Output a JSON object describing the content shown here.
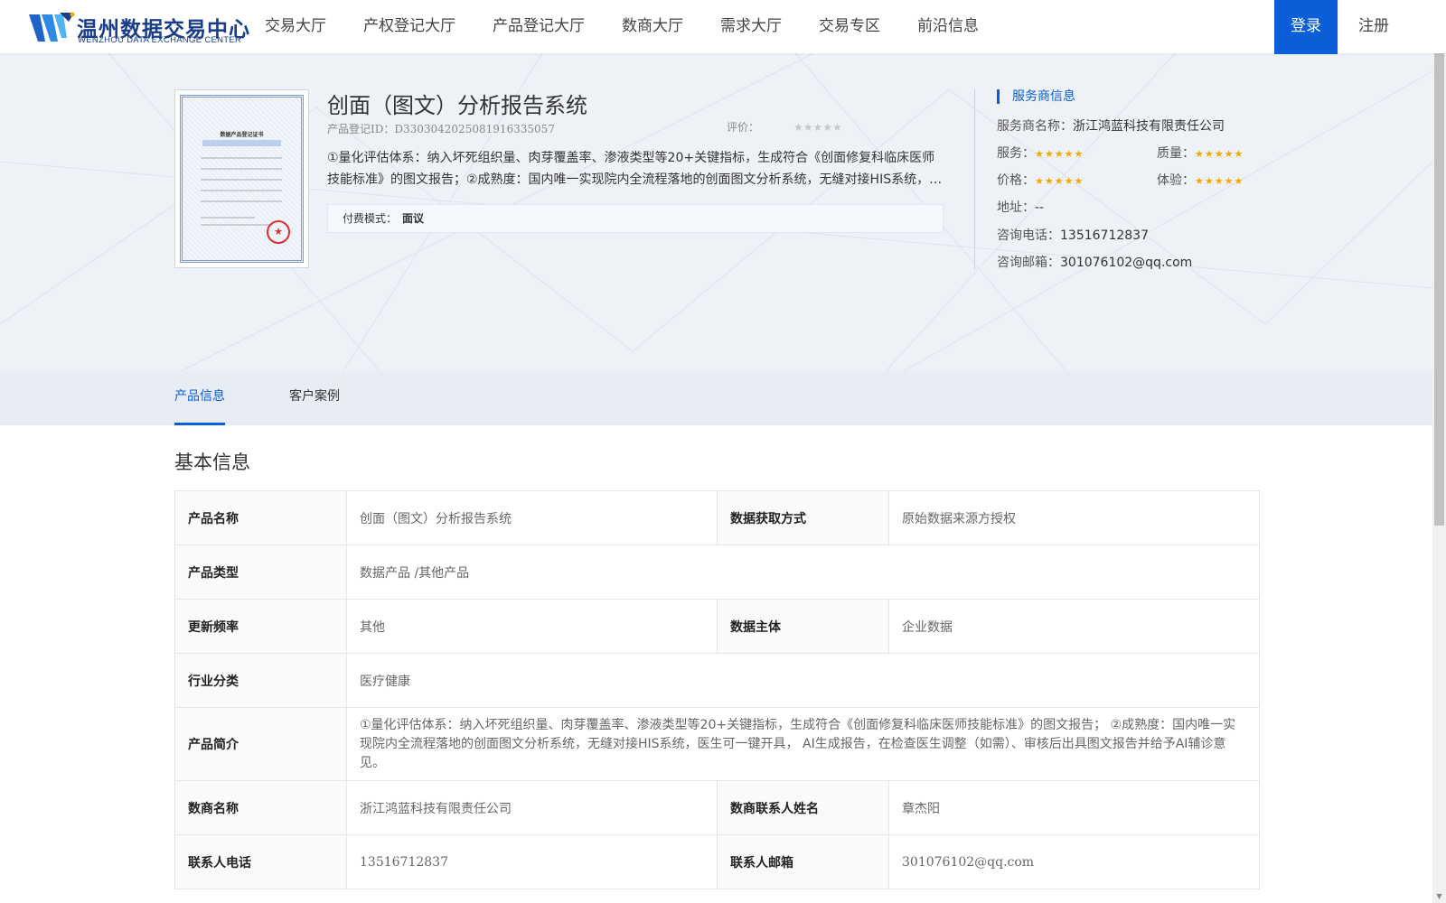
{
  "header": {
    "logo_cn": "温州数据交易中心",
    "logo_en": "WENZHOU DATA EXCHANGE CENTER",
    "nav": [
      "交易大厅",
      "产权登记大厅",
      "产品登记大厅",
      "数商大厅",
      "需求大厅",
      "交易专区",
      "前沿信息"
    ],
    "login_label": "登录",
    "register_label": "注册"
  },
  "product": {
    "title": "创面（图文）分析报告系统",
    "id_text": "产品登记ID：D3303042025081916335057",
    "rating_label": "评价：",
    "rating_stars": "★★★★★",
    "rating_value": 0,
    "description": "①量化评估体系：纳入坏死组织量、肉芽覆盖率、渗液类型等20+关键指标，生成符合《创面修复科临床医师技能标准》的图文报告；②成熟度：国内唯一实现院内全流程落地的创面图文分析系统，无缝对接HIS系统，医生可一键开具，AI生成报告，在检查医生调整（如需）、审核后出具图文报告并给予AI辅诊意见。",
    "pay_label": "付费模式：",
    "pay_value": "面议",
    "cert_title": "数据产品登记证书"
  },
  "provider": {
    "heading": "服务商信息",
    "name_label": "服务商名称：",
    "name_value": "浙江鸿蓝科技有限责任公司",
    "service_label": "服务：",
    "quality_label": "质量：",
    "price_label": "价格：",
    "experience_label": "体验：",
    "stars": "★★★★★",
    "ratings": {
      "service": 5,
      "quality": 5,
      "price": 5,
      "experience": 5
    },
    "address_label": "地址：",
    "address_value": "--",
    "phone_label": "咨询电话：",
    "phone_value": "13516712837",
    "email_label": "咨询邮箱：",
    "email_value": "301076102@qq.com"
  },
  "tabs": [
    {
      "label": "产品信息",
      "active": true
    },
    {
      "label": "客户案例",
      "active": false
    }
  ],
  "basic_info": {
    "title": "基本信息",
    "rows": [
      {
        "k1": "产品名称",
        "v1": "创面（图文）分析报告系统",
        "k2": "数据获取方式",
        "v2": "原始数据来源方授权"
      },
      {
        "k1": "产品类型",
        "v1": "数据产品 /其他产品"
      },
      {
        "k1": "更新频率",
        "v1": "其他",
        "k2": "数据主体",
        "v2": "企业数据"
      },
      {
        "k1": "行业分类",
        "v1": "医疗健康"
      },
      {
        "k1": "产品简介",
        "v1": "①量化评估体系：纳入坏死组织量、肉芽覆盖率、渗液类型等20+关键指标，生成符合《创面修复科临床医师技能标准》的图文报告； ②成熟度：国内唯一实现院内全流程落地的创面图文分析系统，无缝对接HIS系统，医生可一键开具， AI生成报告，在检查医生调整（如需）、审核后出具图文报告并给予AI辅诊意见。"
      },
      {
        "k1": "数商名称",
        "v1": "浙江鸿蓝科技有限责任公司",
        "k2": "数商联系人姓名",
        "v2": "章杰阳"
      },
      {
        "k1": "联系人电话",
        "v1": "13516712837",
        "k2": "联系人邮箱",
        "v2": "301076102@qq.com"
      }
    ]
  },
  "colors": {
    "brand_blue": "#0a5fd8",
    "star_gold": "#f2a900",
    "hero_bg": "#eef1f6",
    "tab_bg": "#e8edf5"
  },
  "icons": [
    "logo-mark-icon",
    "star-icon",
    "seal-icon",
    "scroll-up-icon",
    "scroll-down-icon"
  ]
}
